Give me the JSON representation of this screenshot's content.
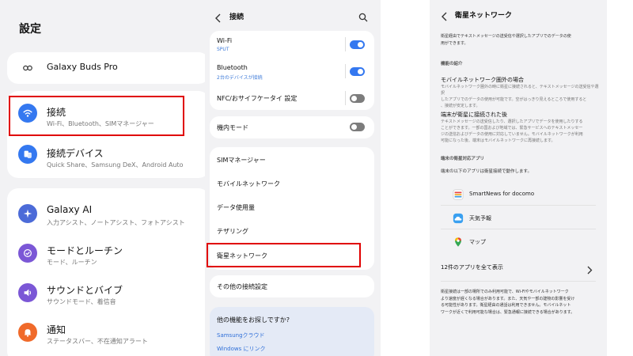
{
  "settings_panel": {
    "title": "設定",
    "buds": {
      "label": "Galaxy Buds Pro"
    },
    "connections": {
      "label": "接続",
      "subtitle": "Wi-Fi、Bluetooth、SIMマネージャー"
    },
    "connected_devices": {
      "label": "接続デバイス",
      "subtitle": "Quick Share、Samsung DeX、Android Auto"
    },
    "galaxy_ai": {
      "label": "Galaxy AI",
      "subtitle": "入力アシスト、ノートアシスト、フォトアシスト"
    },
    "modes": {
      "label": "モードとルーチン",
      "subtitle": "モード、ルーチン"
    },
    "sound": {
      "label": "サウンドとバイブ",
      "subtitle": "サウンドモード、着信音"
    },
    "notifications": {
      "label": "通知",
      "subtitle": "ステータスバー、不在通知アラート"
    }
  },
  "connections_panel": {
    "title": "接続",
    "wifi": {
      "label": "Wi-Fi",
      "subtitle": "SPUT",
      "enabled": true
    },
    "bluetooth": {
      "label": "Bluetooth",
      "subtitle": "2台のデバイスが接続",
      "enabled": true
    },
    "nfc": {
      "label": "NFC/おサイフケータイ 設定",
      "enabled": false
    },
    "airplane": {
      "label": "機内モード",
      "enabled": false
    },
    "sim_manager": {
      "label": "SIMマネージャー"
    },
    "mobile_network": {
      "label": "モバイルネットワーク"
    },
    "data_usage": {
      "label": "データ使用量"
    },
    "tethering": {
      "label": "テザリング"
    },
    "satellite_network": {
      "label": "衛星ネットワーク"
    },
    "other_settings": {
      "label": "その他の接続設定"
    },
    "suggestions": {
      "title": "他の機能をお探しですか?",
      "link1": "Samsungクラウド",
      "link2": "Windows にリンク"
    }
  },
  "satellite_panel": {
    "title": "衛星ネットワーク",
    "intro_line1": "衛星経由でテキストメッセージの送受信や選択したアプリでのデータの使",
    "intro_line2": "用ができます。",
    "feature_heading": "機能の紹介",
    "out_of_range": {
      "title": "モバイルネットワーク圏外の場合",
      "line1": "モバイルネットワーク圏外の時に衛星に接続されると、テキストメッセージの送受信や選択",
      "line2": "したアプリでのデータの使用が可能です。空がはっきり見えるところで使用すると",
      "line3": "、接続が安定します。"
    },
    "connected": {
      "title": "端末が衛星に接続された後",
      "line1": "テキストメッセージの送受信したり、選択したアプリでデータを使用したりする",
      "line2": "ことができます。一部の国および地域では、緊急サービスへのテキストメッセー",
      "line3": "ジの送信およびデータの使用に対応していません。モバイルネットワークが利用",
      "line4": "可能になった後、端末はモバイルネットワークに再接続します。"
    },
    "apps_heading": "端末の衛星対応アプリ",
    "apps_desc": "端末の以下のアプリは衛星接続で動作します。",
    "apps": [
      {
        "name": "SmartNews for docomo",
        "icon": "smartnews-icon"
      },
      {
        "name": "天気予報",
        "icon": "weather-icon"
      },
      {
        "name": "マップ",
        "icon": "maps-icon"
      }
    ],
    "show_all": "12件のアプリを全て表示",
    "note_line1": "衛星接続は一部の場所でのみ利用可能で、Wi-Fiやモバイルネットワーク",
    "note_line2": "より速度が遅くなる場合があります。また、天気や一部の建物の影響を受け",
    "note_line3": "る可能性があります。衛星経由の通話は利用できません。モバイルネット",
    "note_line4": "ワークが近くで利用可能な場合は、緊急通報に接続できる場合があります。"
  },
  "colors": {
    "accent_blue": "#3478f0",
    "highlight_red": "#e00000",
    "background": "#f2f2f4"
  }
}
